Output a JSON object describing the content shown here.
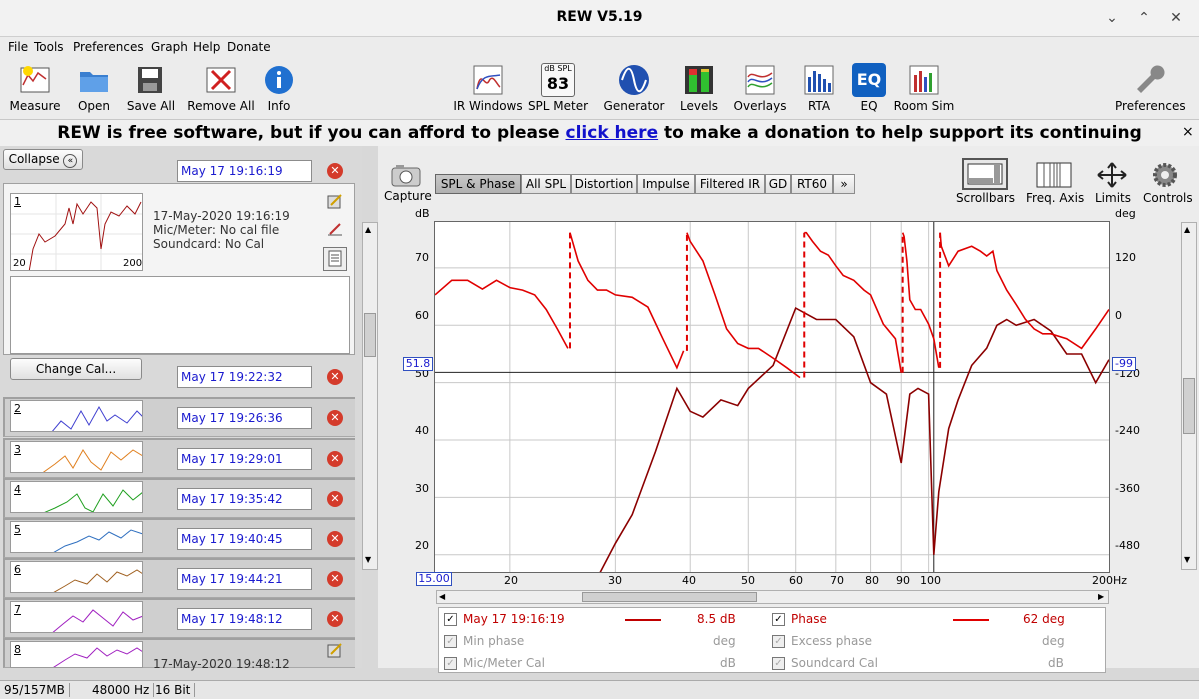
{
  "window": {
    "title": "REW V5.19"
  },
  "menu": [
    "File",
    "Tools",
    "Preferences",
    "Graph",
    "Help",
    "Donate"
  ],
  "toolbar": {
    "measure": "Measure",
    "open": "Open",
    "save_all": "Save All",
    "remove_all": "Remove All",
    "info": "Info",
    "ir_windows": "IR Windows",
    "spl_meter": "SPL Meter",
    "spl_meter_icon_top": "dB SPL",
    "spl_meter_icon_value": "83",
    "generator": "Generator",
    "levels": "Levels",
    "overlays": "Overlays",
    "rta": "RTA",
    "eq": "EQ",
    "eq_icon": "EQ",
    "room_sim": "Room Sim",
    "preferences": "Preferences"
  },
  "banner": {
    "text_before": "REW is free software, but if you can afford to please ",
    "link": "click here",
    "text_after": " to make a donation to help support its continuing development",
    "close": "×"
  },
  "left": {
    "collapse": "Collapse",
    "change_cal": "Change Cal...",
    "selected": {
      "num": "1",
      "date_label": "May 17 19:16:19",
      "date": "17-May-2020 19:16:19",
      "mic": "Mic/Meter: No cal file",
      "soundcard": "Soundcard: No Cal",
      "x_min": "20",
      "x_max": "200"
    },
    "measurements": [
      {
        "num": "2",
        "label": "May 17 19:22:32",
        "color": "#4040d0"
      },
      {
        "num": "3",
        "label": "May 17 19:26:36",
        "color": "#e08020"
      },
      {
        "num": "4",
        "label": "May 17 19:29:01",
        "color": "#20a020"
      },
      {
        "num": "5",
        "label": "May 17 19:35:42",
        "color": "#3070c0"
      },
      {
        "num": "6",
        "label": "May 17 19:40:45",
        "color": "#a06020"
      },
      {
        "num": "7",
        "label": "May 17 19:44:21",
        "color": "#a020c0"
      },
      {
        "num": "8",
        "label": "May 17 19:48:12",
        "color": "#a020c0",
        "date": "17-May-2020 19:48:12"
      }
    ]
  },
  "graph": {
    "capture": "Capture",
    "tabs": [
      "SPL & Phase",
      "All SPL",
      "Distortion",
      "Impulse",
      "Filtered IR",
      "GD",
      "RT60",
      "»"
    ],
    "right_tools": {
      "scrollbars": "Scrollbars",
      "freq_axis": "Freq. Axis",
      "limits": "Limits",
      "controls": "Controls"
    },
    "y_left_unit": "dB",
    "y_right_unit": "deg",
    "y_left_ticks": [
      "70",
      "60",
      "50",
      "40",
      "30",
      "20"
    ],
    "y_right_ticks": [
      "120",
      "0",
      "-120",
      "-240",
      "-360",
      "-480"
    ],
    "x_ticks": [
      "20",
      "30",
      "40",
      "50",
      "60",
      "70",
      "80",
      "90",
      "100",
      "200Hz"
    ],
    "x_start": "15.00",
    "cursor_left": "51.8",
    "cursor_right": "-99"
  },
  "legend": {
    "row1": {
      "name": "May 17 19:16:19",
      "value": "8.5 dB",
      "phase_label": "Phase",
      "phase_value": "62 deg"
    },
    "row2": {
      "name": "Min phase",
      "unit": "deg",
      "name2": "Excess phase",
      "unit2": "deg"
    },
    "row3": {
      "name": "Mic/Meter Cal",
      "unit": "dB",
      "name2": "Soundcard Cal",
      "unit2": "dB"
    }
  },
  "status": {
    "memory": "95/157MB",
    "rate": "48000 Hz",
    "bits": "16 Bit"
  },
  "chart_data": {
    "type": "line",
    "x_scale": "log",
    "xlim": [
      15,
      200
    ],
    "ylim_left": [
      17,
      78
    ],
    "ylim_right": [
      -540,
      180
    ],
    "series": [
      {
        "name": "May 17 19:16:19",
        "axis": "left",
        "color": "#8b0000",
        "x": [
          15,
          18,
          20,
          22,
          24,
          26,
          28,
          30,
          32,
          35,
          38,
          40,
          42,
          45,
          48,
          50,
          55,
          60,
          65,
          70,
          75,
          80,
          85,
          90,
          93,
          96,
          100,
          102,
          104,
          108,
          112,
          118,
          125,
          130,
          135,
          140,
          150,
          160,
          170,
          180,
          190,
          200
        ],
        "y": [
          -10,
          -10,
          -10,
          -10,
          -10,
          -10,
          16,
          22,
          27,
          38,
          49,
          45,
          44,
          47,
          46,
          49,
          53,
          63,
          61,
          61,
          58,
          50,
          48,
          36,
          48,
          49,
          48,
          20,
          31,
          42,
          47,
          53,
          56,
          60,
          61,
          60,
          61,
          59,
          55,
          55,
          50,
          54
        ]
      },
      {
        "name": "Phase",
        "axis": "right",
        "color": "#e00000",
        "x": [
          15,
          16,
          17,
          18,
          19,
          20,
          21,
          22,
          23,
          24,
          25,
          25.2,
          26,
          27,
          28,
          29,
          30,
          32,
          34,
          36,
          38,
          39,
          39.5,
          40,
          42,
          44,
          46,
          48,
          50,
          52,
          55,
          58,
          61,
          62,
          62.5,
          64,
          66,
          68,
          70,
          72,
          75,
          78,
          80,
          84,
          88,
          90,
          90.5,
          91,
          92,
          93,
          95,
          97,
          100,
          102,
          104,
          104.5,
          105,
          108,
          112,
          118,
          122,
          125,
          128,
          130,
          135,
          140,
          145,
          150,
          155,
          160,
          170,
          180,
          190,
          200
        ],
        "y": [
          30,
          60,
          60,
          42,
          60,
          45,
          40,
          30,
          0,
          -40,
          -80,
          158,
          100,
          60,
          40,
          40,
          30,
          25,
          5,
          -60,
          -120,
          -85,
          158,
          140,
          100,
          30,
          -40,
          -70,
          -80,
          -80,
          -100,
          -120,
          -140,
          158,
          158,
          140,
          120,
          112,
          90,
          70,
          60,
          40,
          30,
          -30,
          -60,
          -130,
          158,
          150,
          100,
          20,
          0,
          0,
          -30,
          -60,
          -120,
          158,
          130,
          90,
          120,
          130,
          120,
          110,
          120,
          80,
          40,
          10,
          -20,
          -40,
          -50,
          -50,
          -60,
          -80,
          -40,
          0
        ]
      }
    ]
  }
}
